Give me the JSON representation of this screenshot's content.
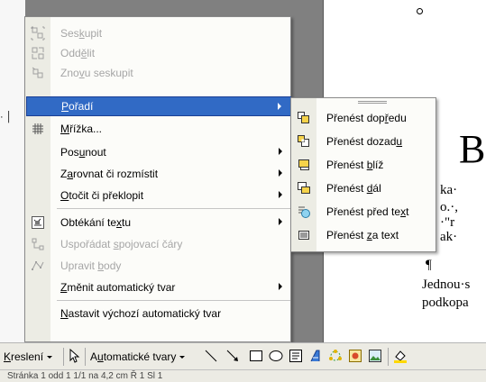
{
  "document": {
    "big_letter": "B",
    "lines": [
      "ka·",
      "o.·,",
      "·\"r",
      "ak·",
      "¶",
      "Jednou·s",
      "podkopa"
    ],
    "ruler_mark": "· │"
  },
  "menu": {
    "items": [
      {
        "label": "Seskupit",
        "accel": "k",
        "disabled": true,
        "icon": "group-icon"
      },
      {
        "label": "Oddělit",
        "accel": "ě",
        "disabled": true,
        "icon": "ungroup-icon"
      },
      {
        "label": "Znovu seskupit",
        "accel": "v",
        "disabled": true,
        "icon": "regroup-icon"
      },
      {
        "label": "Pořadí",
        "accel": "P",
        "disabled": false,
        "highlighted": true,
        "submenu": true
      },
      {
        "label": "Mřížka...",
        "accel": "M",
        "disabled": false,
        "icon": "grid-icon"
      },
      {
        "label": "Posunout",
        "accel": "u",
        "disabled": false,
        "submenu": true
      },
      {
        "label": "Zarovnat či rozmístit",
        "accel": "a",
        "disabled": false,
        "submenu": true
      },
      {
        "label": "Otočit či překlopit",
        "accel": "O",
        "disabled": false,
        "submenu": true
      },
      {
        "label": "Obtékání textu",
        "accel": "x",
        "disabled": false,
        "submenu": true,
        "icon": "text-wrap-icon"
      },
      {
        "label": "Uspořádat spojovací čáry",
        "accel": "s",
        "disabled": true,
        "icon": "connector-icon"
      },
      {
        "label": "Upravit body",
        "accel": "b",
        "disabled": true,
        "icon": "edit-points-icon"
      },
      {
        "label": "Změnit automatický tvar",
        "accel": "Z",
        "disabled": false,
        "submenu": true
      },
      {
        "label": "Nastavit výchozí automatický tvar",
        "accel": "N",
        "disabled": false
      }
    ]
  },
  "submenu": {
    "items": [
      {
        "label": "Přenést dopředu",
        "icon": "bring-to-front-icon"
      },
      {
        "label": "Přenést dozadu",
        "icon": "send-to-back-icon"
      },
      {
        "label": "Přenést blíž",
        "icon": "bring-forward-icon"
      },
      {
        "label": "Přenést dál",
        "icon": "send-backward-icon"
      },
      {
        "label": "Přenést před text",
        "icon": "bring-in-front-of-text-icon"
      },
      {
        "label": "Přenést za text",
        "icon": "send-behind-text-icon"
      }
    ]
  },
  "toolbar": {
    "draw_label": "Kreslení",
    "autoshapes_label": "Automatické tvary"
  },
  "statusbar": {
    "text": "Stránka 1    odd 1       1/1     na  4,2 cm   Ř  1   Sl  1"
  },
  "colors": {
    "highlight": "#316ac5",
    "menu_bg": "#fcfcf9",
    "gutter": "#ecece4"
  }
}
